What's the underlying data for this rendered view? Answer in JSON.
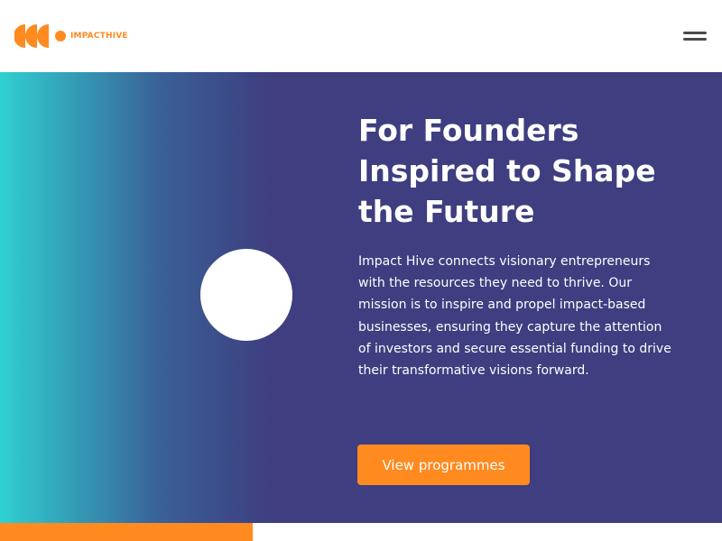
{
  "header": {
    "logo_text": "IMPACTHIVE",
    "menu_icon": "hamburger-menu-icon"
  },
  "hero": {
    "title": "For Founders Inspired to Shape the Future",
    "description": "Impact Hive connects visionary entrepreneurs with the resources they need to thrive. Our mission is to inspire and propel impact-based businesses, ensuring they capture the attention of investors and secure essential funding to drive their transformative visions forward.",
    "cta_label": "View programmes"
  },
  "colors": {
    "brand_orange": "#ff8a1f",
    "hero_purple": "#3e3e80",
    "hero_teal": "#2fd0d2",
    "white": "#ffffff"
  }
}
